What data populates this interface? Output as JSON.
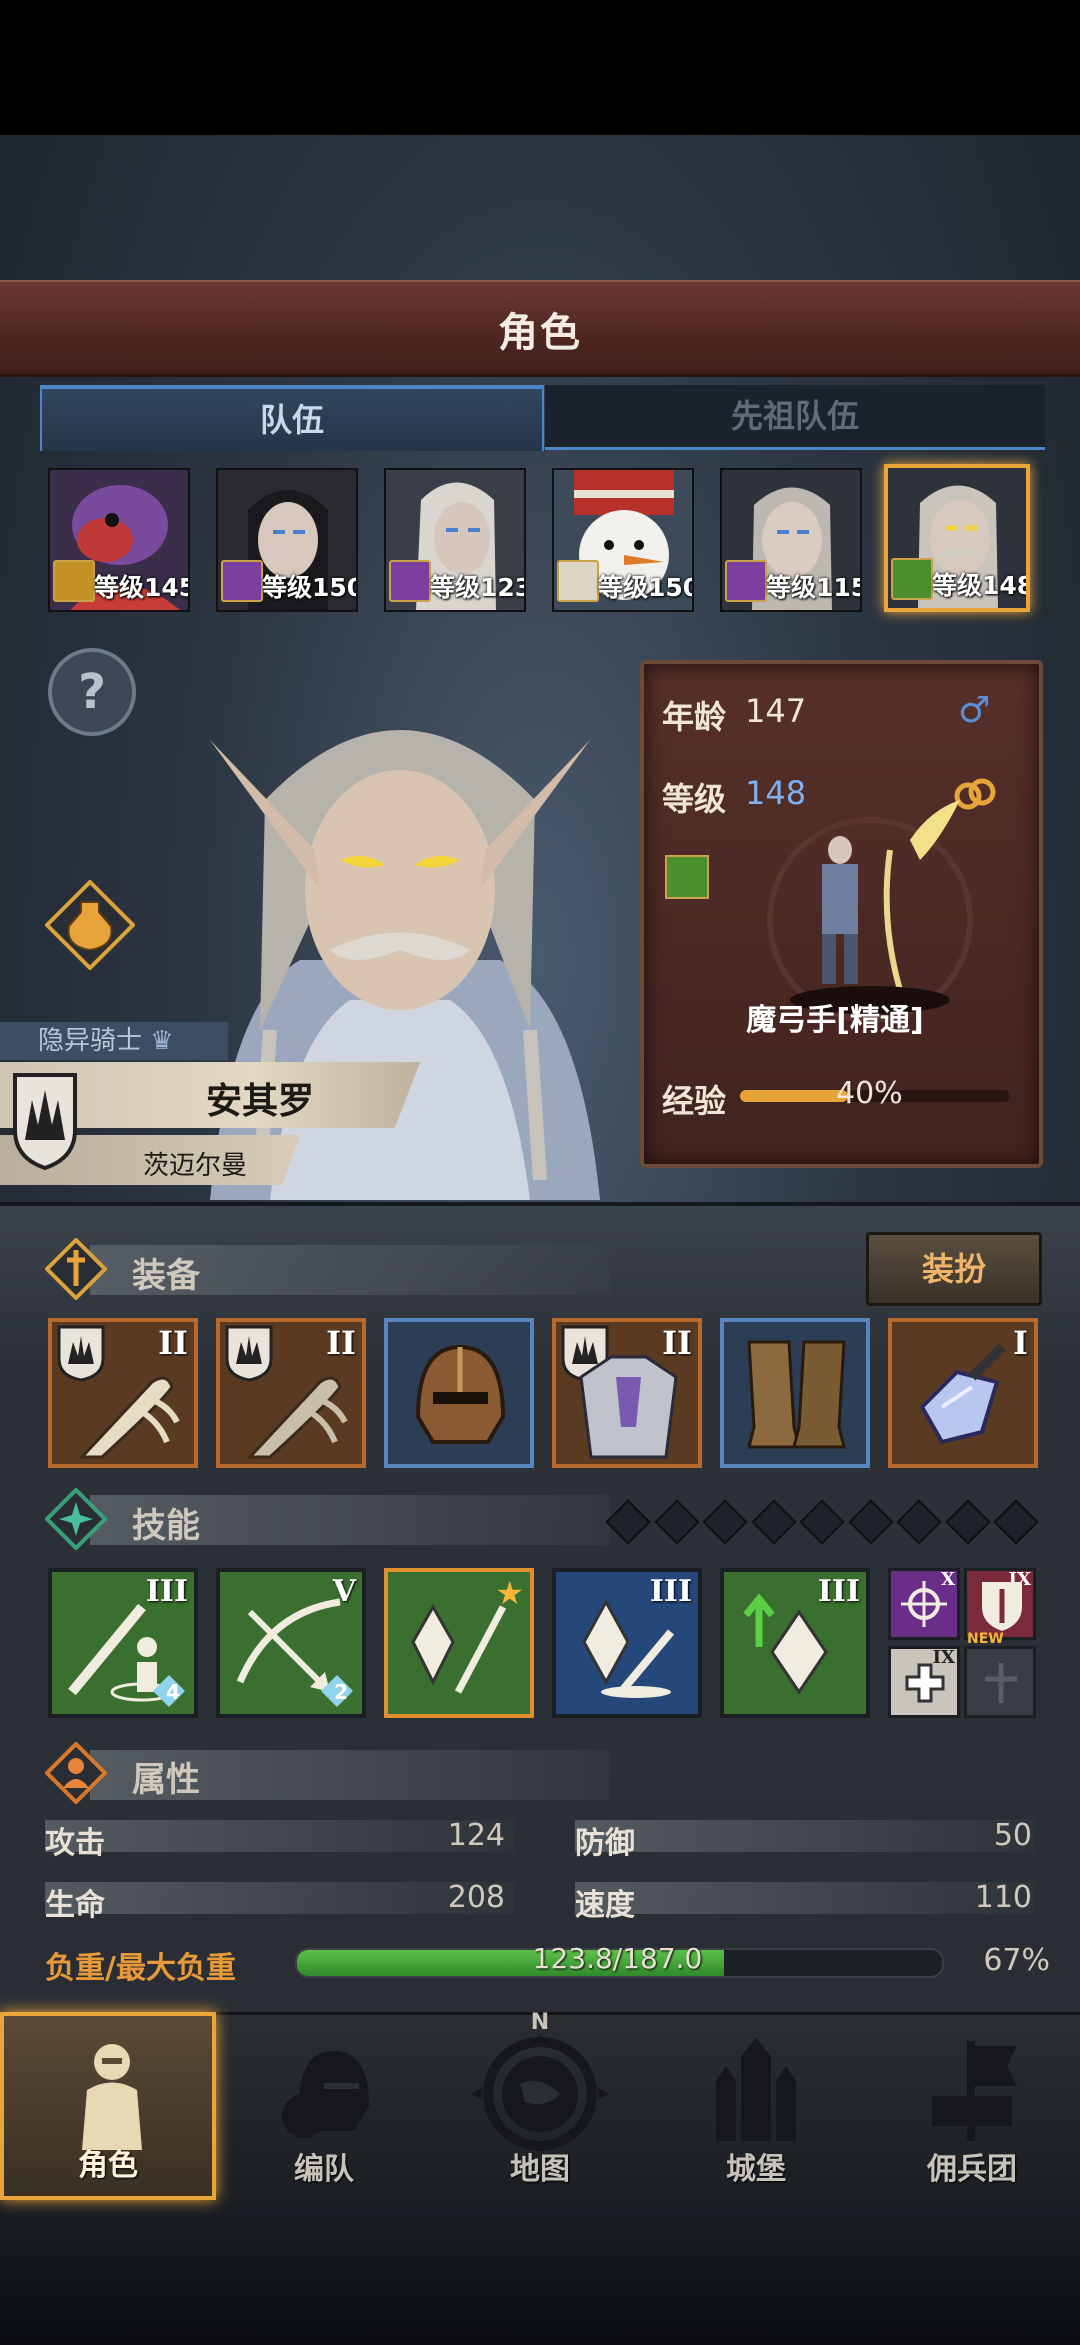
{
  "title": "角色",
  "tabs": [
    {
      "label": "队伍",
      "active": true
    },
    {
      "label": "先祖队伍",
      "active": false
    }
  ],
  "heroes": [
    {
      "level_text": "等级145",
      "class_icon": "shield-class-icon",
      "portrait": "turkey-hero-portrait"
    },
    {
      "level_text": "等级150",
      "class_icon": "staff-class-icon",
      "portrait": "dark-haired-elf-portrait"
    },
    {
      "level_text": "等级123",
      "class_icon": "staff-class-icon",
      "portrait": "bearded-elf-portrait"
    },
    {
      "level_text": "等级150",
      "class_icon": "horse-class-icon",
      "portrait": "snowman-portrait"
    },
    {
      "level_text": "等级115",
      "class_icon": "staff-class-icon",
      "portrait": "silver-elf-portrait"
    },
    {
      "level_text": "等级148",
      "class_icon": "bow-class-icon",
      "portrait": "mustache-elf-portrait",
      "selected": true
    }
  ],
  "character": {
    "title_tag": "隐异骑士",
    "name": "安其罗",
    "origin": "茨迈尔曼",
    "age_label": "年龄",
    "age": "147",
    "level_label": "等级",
    "level": "148",
    "class_name": "魔弓手[精通]",
    "exp_label": "经验",
    "exp_percent": "40%",
    "exp_fraction": 0.4,
    "gender_icon": "male-icon",
    "ring_icon": "rings-icon"
  },
  "equipment": {
    "title": "装备",
    "dress_button": "装扮",
    "slots": [
      {
        "name": "bone-sword",
        "rank": "II",
        "frame": "orange",
        "badge": true
      },
      {
        "name": "bone-sword",
        "rank": "II",
        "frame": "orange",
        "badge": true
      },
      {
        "name": "leather-helmet",
        "rank": "",
        "frame": "blue",
        "badge": false
      },
      {
        "name": "crystal-armor",
        "rank": "II",
        "frame": "orange",
        "badge": true
      },
      {
        "name": "leather-boots",
        "rank": "",
        "frame": "blue",
        "badge": false
      },
      {
        "name": "crystal-arrow",
        "rank": "I",
        "frame": "orange",
        "badge": false
      }
    ]
  },
  "skills": {
    "title": "技能",
    "main": [
      {
        "name": "sword-skill",
        "rank": "III",
        "gem": "4",
        "color": "green"
      },
      {
        "name": "arrow-skill",
        "rank": "V",
        "gem": "2",
        "color": "green"
      },
      {
        "name": "crystal-spear-skill",
        "rank": "",
        "gem": "",
        "color": "green",
        "starred": true
      },
      {
        "name": "crystal-sword-skill",
        "rank": "III",
        "gem": "",
        "color": "blue"
      },
      {
        "name": "crystal-up-skill",
        "rank": "III",
        "gem": "",
        "color": "green"
      }
    ],
    "small": [
      {
        "name": "target-skill",
        "rank": "X"
      },
      {
        "name": "shield-skill",
        "rank": "IX"
      },
      {
        "name": "heal-skill",
        "rank": "IX"
      },
      {
        "name": "locked-skill",
        "rank": "NEW"
      }
    ]
  },
  "attributes": {
    "title": "属性",
    "attack_label": "攻击",
    "attack": "124",
    "defense_label": "防御",
    "defense": "50",
    "hp_label": "生命",
    "hp": "208",
    "speed_label": "速度",
    "speed": "110",
    "weight_label": "负重/最大负重",
    "weight_text": "123.8/187.0",
    "weight_percent": "67%",
    "weight_fraction": 0.662
  },
  "nav": [
    {
      "label": "角色",
      "active": true
    },
    {
      "label": "编队"
    },
    {
      "label": "地图"
    },
    {
      "label": "城堡"
    },
    {
      "label": "佣兵团"
    }
  ],
  "compass_letter": "N",
  "colors": {
    "accent": "#e9a43a",
    "tab_blue": "#4a86c8",
    "panel_brown": "#4e2620"
  }
}
